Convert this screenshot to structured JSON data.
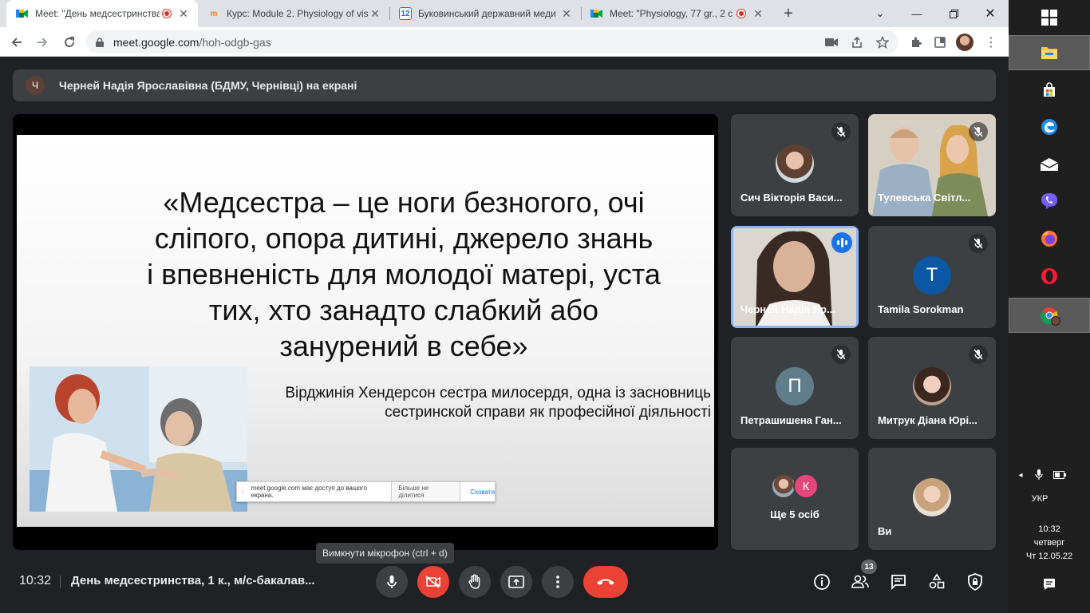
{
  "browser": {
    "tabs": [
      {
        "title": "Meet: \"День медсестринства",
        "recording": true,
        "favicon": "meet"
      },
      {
        "title": "Курс: Module 2. Physiology of vis",
        "recording": false,
        "favicon": "moodle"
      },
      {
        "title": "Буковинський державний меди",
        "recording": false,
        "favicon": "calendar-12"
      },
      {
        "title": "Meet: \"Physiology, 77 gr., 2 c",
        "recording": true,
        "favicon": "meet"
      }
    ],
    "calendar_favicon_text": "12",
    "new_tab_label": "+",
    "url_host": "meet.google.com",
    "url_path": "/hoh-odgb-gas"
  },
  "meet": {
    "presenter_avatar_letter": "Ч",
    "presenting_banner": "Черней Надія Ярославівна (БДМУ, Чернівці) на екрані",
    "slide": {
      "quote_lines": [
        "«Медсестра – це ноги безногого, очі",
        "сліпого, опора дитині, джерело знань",
        "і впевненість для молодої матері, уста",
        "тих, хто занадто слабкий або",
        "занурений в себе»"
      ],
      "author_lines": [
        "Вірджинія Хендерсон сестра милосердя, одна із засновниць",
        "сестринской справи як професійної діяльності"
      ],
      "share_notice": {
        "message": "meet.google.com має доступ до вашого екрана.",
        "stop_label": "Більше не ділитися",
        "hide_label": "Сховати"
      }
    },
    "participants": [
      {
        "name": "Сич Вікторія Васи...",
        "muted": true,
        "avatar_type": "photo"
      },
      {
        "name": "Тулевська Світл...",
        "muted": true,
        "avatar_type": "video"
      },
      {
        "name": "Черней Надія Яр...",
        "muted": false,
        "speaking": true,
        "avatar_type": "video"
      },
      {
        "name": "Tamila Sorokman",
        "muted": true,
        "avatar_type": "letter",
        "letter": "T",
        "color": "#0b57a3"
      },
      {
        "name": "Петрашишена Ган...",
        "muted": true,
        "avatar_type": "letter",
        "letter": "П",
        "color": "#607d8b"
      },
      {
        "name": "Митрук Діана Юрі...",
        "muted": true,
        "avatar_type": "photo"
      },
      {
        "name": "Ще 5 осіб",
        "muted": false,
        "avatar_type": "group",
        "letter": "К",
        "color": "#e8457a"
      },
      {
        "name": "Ви",
        "muted": false,
        "avatar_type": "photo"
      }
    ],
    "tooltip": "Вимкнути мікрофон (ctrl + d)",
    "bottom": {
      "time": "10:32",
      "meeting_title": "День медсестринства, 1 к., м/с-бакалав...",
      "people_count": "13"
    }
  },
  "taskbar": {
    "language": "УКР",
    "time": "10:32",
    "weekday": "четверг",
    "date": "Чт 12.05.22"
  },
  "colors": {
    "meet_bg": "#202124",
    "tile_bg": "#3c4043",
    "end_call": "#ea4335",
    "speaking_ring": "#8ab4f8"
  }
}
